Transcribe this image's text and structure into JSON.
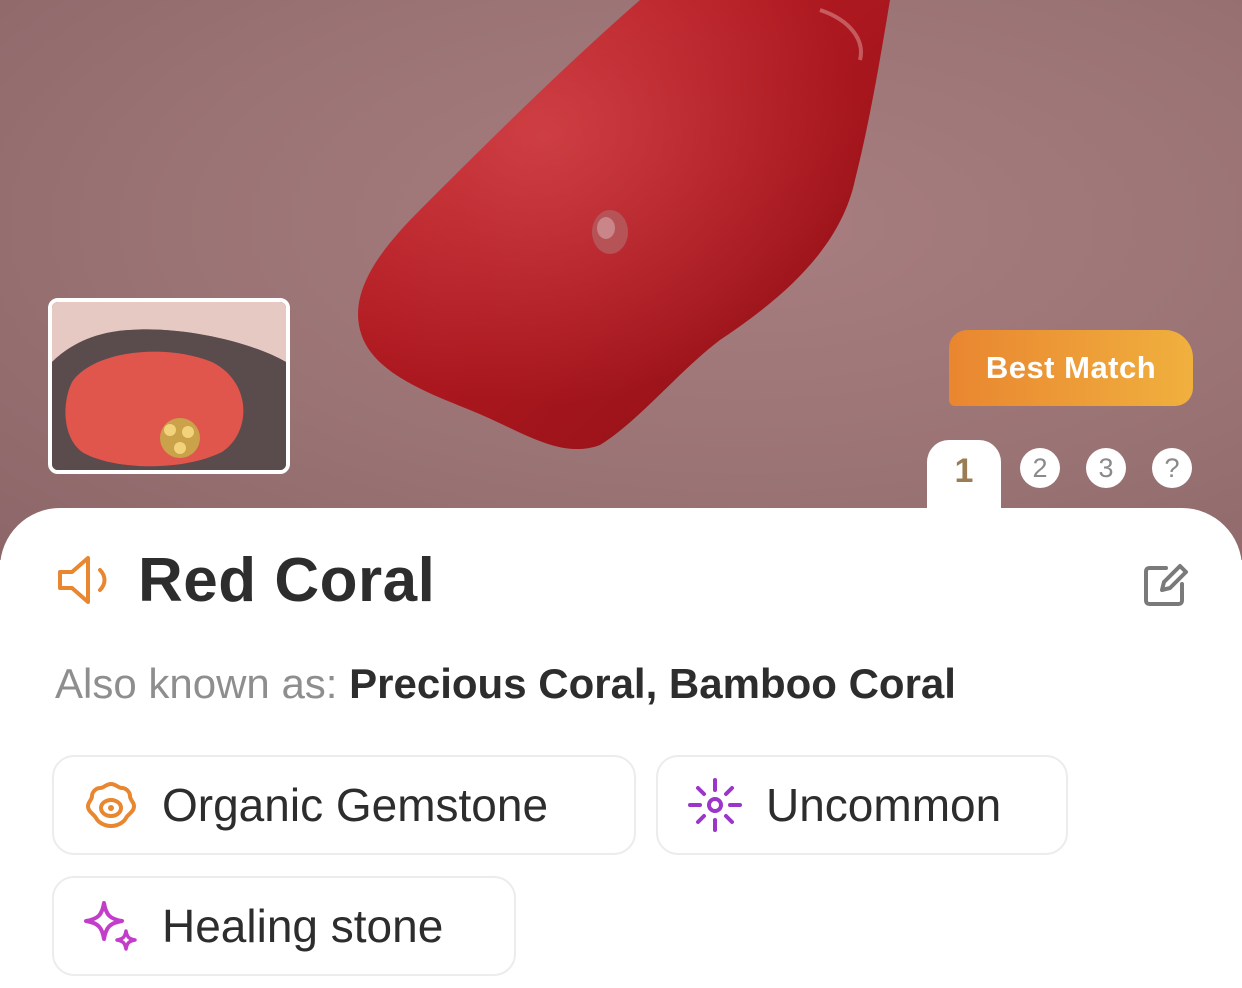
{
  "hero": {
    "badge_label": "Best Match",
    "pages": [
      {
        "label": "1",
        "active": true
      },
      {
        "label": "2",
        "active": false
      },
      {
        "label": "3",
        "active": false
      },
      {
        "label": "?",
        "active": false
      }
    ]
  },
  "specimen": {
    "name": "Red Coral",
    "aka_label": "Also known as:",
    "aka_names": "Precious Coral, Bamboo Coral"
  },
  "tags": [
    {
      "label": "Organic Gemstone",
      "icon": "shell-icon",
      "color": "#e98630"
    },
    {
      "label": "Uncommon",
      "icon": "sparkle-burst-icon",
      "color": "#9b36c9"
    },
    {
      "label": "Healing stone",
      "icon": "sparkles-icon",
      "color": "#c23dc9"
    }
  ],
  "colors": {
    "accent": "#e98630",
    "title": "#2d2d2d",
    "muted": "#8e8e8e"
  }
}
